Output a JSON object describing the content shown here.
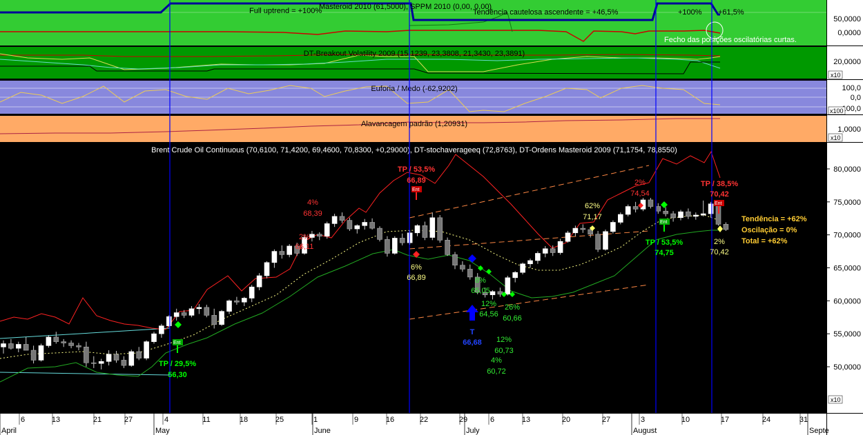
{
  "colors": {
    "panel1_bg": "#33cc33",
    "panel2_bg": "#009900",
    "panel3_bg": "#8888dd",
    "panel4_bg": "#ffaa66",
    "main_bg": "#000000",
    "axis_bg": "#ffffff",
    "blue": "#000099",
    "vline": "#0000ff",
    "red": "#ff0000",
    "green": "#00ff00",
    "yellow": "#ffff99",
    "orange": "#ff8844",
    "white": "#ffffff"
  },
  "panels": {
    "p1": {
      "labels": [
        "Full uptrend = +100%",
        "Masteroid 2010 (61,5000), SPPM 2010 (0,00, 0,00)",
        "Tendência cautelosa ascendente = +46,5%",
        "+100%",
        "+61,5%"
      ],
      "axis": [
        "50,0000",
        "0,0000"
      ],
      "note": "Fecho das posições oscilatórias curtas."
    },
    "p2": {
      "title": "DT-Breakout Volatility 2009 (15,1239, 23,3808, 21,3430, 23,3891)",
      "axis": [
        "20,0000"
      ],
      "scale": "x10"
    },
    "p3": {
      "title": "Euforia / Medo (-62,9202)",
      "axis": [
        "100,0",
        "0,0",
        "-100,0"
      ],
      "scale": "x100"
    },
    "p4": {
      "title": "Alavancagem padrão (1,20931)",
      "axis": [
        "1,0000"
      ],
      "scale": "x10"
    }
  },
  "chart_data": {
    "type": "candlestick",
    "title": "Brent Crude Oil Continuous (70,6100, 71,4200, 69,4600, 70,8300, +0,29000), DT-stochaverageeq (72,8763), DT-Ordens Masteroid 2009 (71,1754, 78,8550)",
    "ylim": [
      45,
      82
    ],
    "y_ticks": [
      50,
      55,
      60,
      65,
      70,
      75,
      80
    ],
    "y_tick_labels": [
      "50,0000",
      "55,0000",
      "60,0000",
      "65,0000",
      "70,0000",
      "75,0000",
      "80,0000"
    ],
    "y_scale_label": "x10",
    "day_ticks": [
      "6",
      "13",
      "21",
      "27",
      "4",
      "11",
      "18",
      "25",
      "1",
      "9",
      "16",
      "22",
      "29",
      "6",
      "13",
      "20",
      "27",
      "3",
      "10",
      "17",
      "24",
      "31"
    ],
    "month_labels": [
      "April",
      "May",
      "June",
      "July",
      "August",
      "Septe"
    ],
    "candles": [
      [
        53,
        54,
        52,
        53.5
      ],
      [
        53.5,
        54.2,
        52.6,
        52.8
      ],
      [
        52.8,
        53.8,
        52.2,
        53.4
      ],
      [
        53.4,
        54.5,
        52.8,
        52.5
      ],
      [
        52.5,
        53.2,
        50.5,
        51.0
      ],
      [
        51.0,
        53.5,
        50.8,
        53.2
      ],
      [
        53.2,
        54.8,
        52.9,
        54.5
      ],
      [
        54.5,
        55.3,
        53.5,
        53.8
      ],
      [
        53.8,
        54.2,
        53.0,
        53.6
      ],
      [
        53.6,
        54.0,
        52.8,
        53.2
      ],
      [
        53.2,
        53.6,
        52.5,
        53.0
      ],
      [
        53.0,
        53.8,
        50.0,
        50.6
      ],
      [
        50.6,
        51.6,
        49.8,
        50.5
      ],
      [
        50.5,
        51.2,
        49.6,
        50.8
      ],
      [
        50.8,
        52.5,
        50.2,
        51.9
      ],
      [
        51.9,
        52.4,
        50.6,
        51.0
      ],
      [
        51.0,
        51.6,
        49.8,
        50.2
      ],
      [
        50.2,
        52.6,
        50.0,
        52.3
      ],
      [
        52.3,
        53.0,
        51.0,
        51.3
      ],
      [
        51.3,
        54.0,
        51.0,
        53.8
      ],
      [
        53.8,
        55.3,
        53.5,
        55.0
      ],
      [
        55.0,
        56.5,
        54.4,
        56.2
      ],
      [
        56.2,
        57.8,
        56.0,
        57.6
      ],
      [
        57.6,
        58.8,
        57.0,
        58.2
      ],
      [
        58.2,
        58.6,
        57.4,
        57.8
      ],
      [
        57.8,
        59.2,
        57.5,
        58.8
      ],
      [
        58.8,
        59.5,
        58.0,
        59.0
      ],
      [
        59.0,
        59.4,
        57.5,
        57.8
      ],
      [
        57.8,
        58.8,
        55.8,
        56.4
      ],
      [
        56.4,
        58.6,
        56.2,
        58.4
      ],
      [
        58.4,
        60.2,
        58.0,
        60.0
      ],
      [
        60.0,
        60.6,
        59.4,
        59.8
      ],
      [
        59.8,
        60.6,
        59.2,
        60.4
      ],
      [
        60.4,
        62.4,
        59.8,
        62.1
      ],
      [
        62.1,
        64.2,
        61.6,
        63.8
      ],
      [
        63.8,
        66.0,
        63.4,
        65.8
      ],
      [
        65.8,
        67.8,
        65.0,
        67.5
      ],
      [
        67.5,
        68.4,
        66.4,
        67.0
      ],
      [
        67.0,
        68.6,
        66.6,
        68.3
      ],
      [
        68.3,
        68.8,
        66.8,
        67.2
      ],
      [
        67.2,
        70.0,
        67.0,
        69.6
      ],
      [
        69.6,
        70.6,
        69.0,
        70.1
      ],
      [
        70.1,
        70.4,
        69.2,
        69.8
      ],
      [
        69.8,
        72.0,
        69.4,
        71.7
      ],
      [
        71.7,
        73.2,
        71.2,
        72.8
      ],
      [
        72.8,
        73.4,
        71.8,
        72.2
      ],
      [
        72.2,
        72.6,
        70.6,
        70.9
      ],
      [
        70.9,
        71.6,
        70.2,
        71.4
      ],
      [
        71.4,
        72.4,
        70.8,
        71.9
      ],
      [
        71.9,
        72.5,
        70.8,
        71.0
      ],
      [
        71.0,
        71.3,
        69.0,
        69.3
      ],
      [
        69.3,
        69.8,
        66.7,
        67.2
      ],
      [
        67.2,
        69.8,
        67.0,
        69.5
      ],
      [
        69.5,
        70.2,
        68.4,
        68.8
      ],
      [
        68.8,
        70.7,
        68.5,
        70.3
      ],
      [
        70.3,
        71.6,
        69.8,
        71.4
      ],
      [
        71.4,
        72.0,
        69.2,
        69.6
      ],
      [
        69.6,
        73.4,
        69.2,
        72.6
      ],
      [
        72.6,
        73.0,
        68.8,
        69.2
      ],
      [
        69.2,
        69.6,
        66.8,
        67.0
      ],
      [
        67.0,
        67.4,
        64.8,
        65.4
      ],
      [
        65.4,
        66.0,
        64.4,
        64.8
      ],
      [
        64.8,
        65.5,
        63.2,
        63.6
      ],
      [
        63.6,
        64.2,
        61.0,
        61.3
      ],
      [
        61.3,
        62.0,
        60.5,
        60.9
      ],
      [
        60.9,
        61.6,
        60.2,
        61.4
      ],
      [
        61.4,
        62.0,
        60.6,
        61.0
      ],
      [
        61.0,
        63.8,
        60.8,
        63.5
      ],
      [
        63.5,
        64.5,
        62.8,
        64.3
      ],
      [
        64.3,
        65.8,
        64.0,
        65.6
      ],
      [
        65.6,
        66.4,
        65.0,
        66.1
      ],
      [
        66.1,
        67.5,
        65.6,
        67.2
      ],
      [
        67.2,
        68.3,
        66.6,
        67.9
      ],
      [
        67.9,
        68.4,
        66.8,
        67.3
      ],
      [
        67.3,
        69.4,
        67.0,
        69.0
      ],
      [
        69.0,
        70.6,
        68.8,
        70.3
      ],
      [
        70.3,
        71.4,
        69.8,
        71.0
      ],
      [
        71.0,
        71.6,
        70.3,
        70.8
      ],
      [
        70.8,
        71.2,
        69.6,
        70.1
      ],
      [
        70.1,
        70.6,
        67.4,
        67.8
      ],
      [
        67.8,
        70.8,
        67.6,
        70.5
      ],
      [
        70.5,
        72.2,
        70.2,
        71.9
      ],
      [
        71.9,
        73.4,
        71.6,
        73.1
      ],
      [
        73.1,
        74.6,
        72.8,
        74.3
      ],
      [
        74.3,
        75.0,
        73.4,
        73.9
      ],
      [
        73.9,
        75.6,
        73.6,
        75.3
      ],
      [
        75.3,
        75.6,
        74.0,
        74.3
      ],
      [
        74.3,
        74.8,
        73.2,
        73.6
      ],
      [
        73.6,
        74.2,
        72.8,
        73.2
      ],
      [
        73.2,
        73.6,
        72.0,
        72.6
      ],
      [
        72.6,
        73.8,
        72.2,
        73.5
      ],
      [
        73.5,
        74.0,
        72.4,
        72.8
      ],
      [
        72.8,
        73.4,
        72.3,
        73.0
      ],
      [
        73.0,
        75.2,
        72.8,
        73.2
      ],
      [
        73.2,
        75.0,
        72.6,
        74.7
      ],
      [
        74.7,
        74.9,
        71.4,
        71.6
      ],
      [
        71.6,
        71.9,
        70.6,
        70.8
      ]
    ],
    "vlines_index": [
      21,
      54,
      86,
      92
    ],
    "annotations": [
      {
        "text": "TP / 29,5%",
        "color": "green"
      },
      {
        "text": "56,30",
        "color": "green"
      },
      {
        "text": "4%",
        "color": "red"
      },
      {
        "text": "68,39",
        "color": "red"
      },
      {
        "text": "2%",
        "color": "red"
      },
      {
        "text": "66,11",
        "color": "red"
      },
      {
        "text": "TP / 53,5%",
        "color": "red"
      },
      {
        "text": "66,89",
        "color": "red"
      },
      {
        "text": "6%",
        "color": "yellow"
      },
      {
        "text": "66,89",
        "color": "yellow"
      },
      {
        "text": "8%",
        "color": "green"
      },
      {
        "text": "65,05",
        "color": "green"
      },
      {
        "text": "12%",
        "color": "green"
      },
      {
        "text": "64,56",
        "color": "green"
      },
      {
        "text": "26%",
        "color": "green"
      },
      {
        "text": "60,66",
        "color": "green"
      },
      {
        "text": "T",
        "color": "blue"
      },
      {
        "text": "66,68",
        "color": "blue"
      },
      {
        "text": "12%",
        "color": "green"
      },
      {
        "text": "60,73",
        "color": "green"
      },
      {
        "text": "4%",
        "color": "green"
      },
      {
        "text": "60,72",
        "color": "green"
      },
      {
        "text": "62%",
        "color": "yellow"
      },
      {
        "text": "71,17",
        "color": "yellow"
      },
      {
        "text": "2%",
        "color": "red"
      },
      {
        "text": "74,54",
        "color": "red"
      },
      {
        "text": "TP / 53,5%",
        "color": "green"
      },
      {
        "text": "74,75",
        "color": "green"
      },
      {
        "text": "TP / 38,5%",
        "color": "red"
      },
      {
        "text": "70,42",
        "color": "red"
      },
      {
        "text": "2%",
        "color": "yellow"
      },
      {
        "text": "70,42",
        "color": "yellow"
      }
    ],
    "summary": [
      "Tendência = +62%",
      "Oscilação = 0%",
      "Total = +62%"
    ],
    "markers": {
      "tag": "Ent"
    }
  }
}
